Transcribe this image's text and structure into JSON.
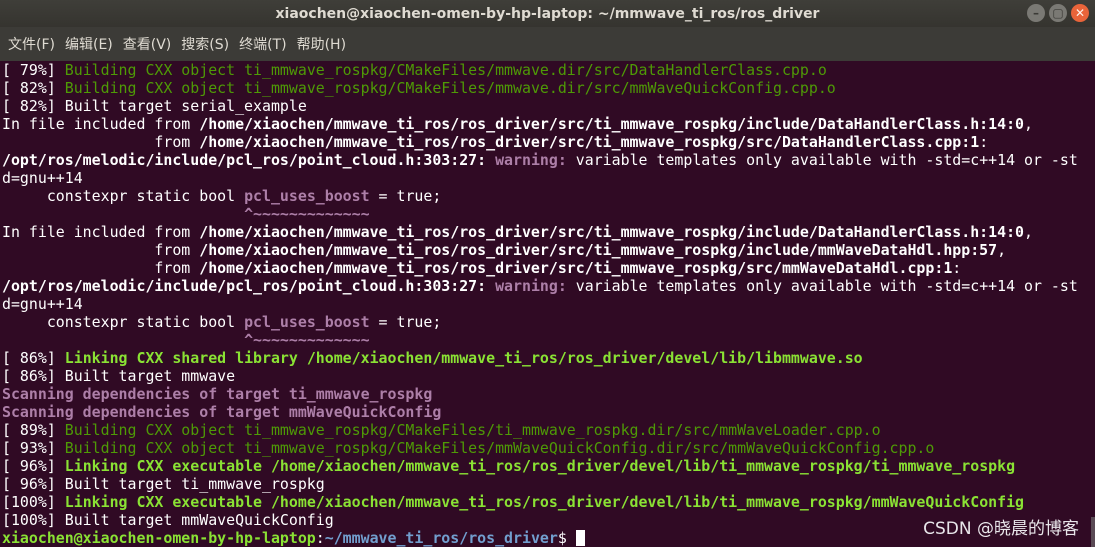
{
  "window": {
    "title": "xiaochen@xiaochen-omen-by-hp-laptop: ~/mmwave_ti_ros/ros_driver",
    "controls": {
      "minimize": "–",
      "maximize": "▢",
      "close": "✕"
    }
  },
  "menu": {
    "file": "文件(F)",
    "edit": "编辑(E)",
    "view": "查看(V)",
    "search": "搜索(S)",
    "terminal": "终端(T)",
    "help": "帮助(H)"
  },
  "terminal": {
    "lines": [
      [
        {
          "t": "[ 79%] "
        },
        {
          "t": "Building CXX object ti_mmwave_rospkg/CMakeFiles/mmwave.dir/src/DataHandlerClass.cpp.o",
          "c": "g"
        }
      ],
      [
        {
          "t": "[ 82%] "
        },
        {
          "t": "Building CXX object ti_mmwave_rospkg/CMakeFiles/mmwave.dir/src/mmWaveQuickConfig.cpp.o",
          "c": "g"
        }
      ],
      [
        {
          "t": "[ 82%] Built target serial_example"
        }
      ],
      [
        {
          "t": "In file included from "
        },
        {
          "t": "/home/xiaochen/mmwave_ti_ros/ros_driver/src/ti_mmwave_rospkg/include/DataHandlerClass.h:14:0",
          "c": "b"
        },
        {
          "t": ","
        }
      ],
      [
        {
          "t": "                 from "
        },
        {
          "t": "/home/xiaochen/mmwave_ti_ros/ros_driver/src/ti_mmwave_rospkg/src/DataHandlerClass.cpp:1",
          "c": "b"
        },
        {
          "t": ":"
        }
      ],
      [
        {
          "t": "/opt/ros/melodic/include/pcl_ros/point_cloud.h:303:27:",
          "c": "b"
        },
        {
          "t": " "
        },
        {
          "t": "warning:",
          "c": "M"
        },
        {
          "t": " variable templates only available with -std=c++14 or -st"
        }
      ],
      [
        {
          "t": "d=gnu++14"
        }
      ],
      [
        {
          "t": "     constexpr static bool "
        },
        {
          "t": "pcl_uses_boost",
          "c": "M"
        },
        {
          "t": " = true;"
        }
      ],
      [
        {
          "t": "                           "
        },
        {
          "t": "^~~~~~~~~~~~~~",
          "c": "M"
        }
      ],
      [
        {
          "t": "In file included from "
        },
        {
          "t": "/home/xiaochen/mmwave_ti_ros/ros_driver/src/ti_mmwave_rospkg/include/DataHandlerClass.h:14:0",
          "c": "b"
        },
        {
          "t": ","
        }
      ],
      [
        {
          "t": "                 from "
        },
        {
          "t": "/home/xiaochen/mmwave_ti_ros/ros_driver/src/ti_mmwave_rospkg/include/mmWaveDataHdl.hpp:57",
          "c": "b"
        },
        {
          "t": ","
        }
      ],
      [
        {
          "t": "                 from "
        },
        {
          "t": "/home/xiaochen/mmwave_ti_ros/ros_driver/src/ti_mmwave_rospkg/src/mmWaveDataHdl.cpp:1",
          "c": "b"
        },
        {
          "t": ":"
        }
      ],
      [
        {
          "t": "/opt/ros/melodic/include/pcl_ros/point_cloud.h:303:27:",
          "c": "b"
        },
        {
          "t": " "
        },
        {
          "t": "warning:",
          "c": "M"
        },
        {
          "t": " variable templates only available with -std=c++14 or -st"
        }
      ],
      [
        {
          "t": "d=gnu++14"
        }
      ],
      [
        {
          "t": "     constexpr static bool "
        },
        {
          "t": "pcl_uses_boost",
          "c": "M"
        },
        {
          "t": " = true;"
        }
      ],
      [
        {
          "t": "                           "
        },
        {
          "t": "^~~~~~~~~~~~~~",
          "c": "M"
        }
      ],
      [
        {
          "t": "[ 86%] "
        },
        {
          "t": "Linking CXX shared library /home/xiaochen/mmwave_ti_ros/ros_driver/devel/lib/libmmwave.so",
          "c": "G"
        }
      ],
      [
        {
          "t": "[ 86%] Built target mmwave"
        }
      ],
      [
        {
          "t": "Scanning dependencies of target ti_mmwave_rospkg",
          "c": "M"
        }
      ],
      [
        {
          "t": "Scanning dependencies of target mmWaveQuickConfig",
          "c": "M"
        }
      ],
      [
        {
          "t": "[ 89%] "
        },
        {
          "t": "Building CXX object ti_mmwave_rospkg/CMakeFiles/ti_mmwave_rospkg.dir/src/mmWaveLoader.cpp.o",
          "c": "g"
        }
      ],
      [
        {
          "t": "[ 93%] "
        },
        {
          "t": "Building CXX object ti_mmwave_rospkg/CMakeFiles/mmWaveQuickConfig.dir/src/mmWaveQuickConfig.cpp.o",
          "c": "g"
        }
      ],
      [
        {
          "t": "[ 96%] "
        },
        {
          "t": "Linking CXX executable /home/xiaochen/mmwave_ti_ros/ros_driver/devel/lib/ti_mmwave_rospkg/ti_mmwave_rospkg",
          "c": "G"
        }
      ],
      [
        {
          "t": "[ 96%] Built target ti_mmwave_rospkg"
        }
      ],
      [
        {
          "t": "[100%] "
        },
        {
          "t": "Linking CXX executable /home/xiaochen/mmwave_ti_ros/ros_driver/devel/lib/ti_mmwave_rospkg/mmWaveQuickConfig",
          "c": "G"
        }
      ],
      [
        {
          "t": "[100%] Built target mmWaveQuickConfig"
        }
      ]
    ],
    "prompt": {
      "user_host": "xiaochen@xiaochen-omen-by-hp-laptop",
      "separator": ":",
      "path": "~/mmwave_ti_ros/ros_driver",
      "symbol": "$ "
    }
  },
  "watermark": "CSDN @晓晨的博客",
  "colors": {
    "background": "#300a24",
    "green": "#4e9a06",
    "bright_green": "#8ae234",
    "magenta": "#ad7fa8",
    "blue": "#729fcf"
  }
}
